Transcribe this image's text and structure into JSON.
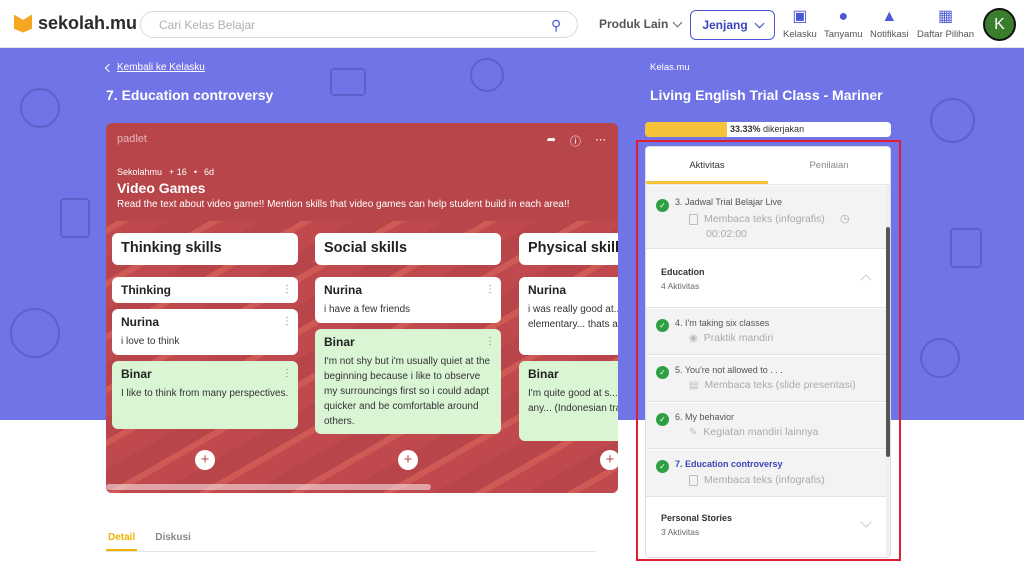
{
  "header": {
    "brand": "sekolah.mu",
    "search_placeholder": "Cari Kelas Belajar",
    "produk_label": "Produk Lain",
    "jenjang_label": "Jenjang",
    "nav": [
      {
        "label": "Kelasku",
        "icon": "book-icon"
      },
      {
        "label": "Tanyamu",
        "icon": "chat-icon"
      },
      {
        "label": "Notifikasi",
        "icon": "bell-icon"
      },
      {
        "label": "Daftar Pilihan",
        "icon": "bag-icon"
      }
    ],
    "avatar_initial": "K"
  },
  "content": {
    "back_label": "Kembali ke Kelasku",
    "title": "7. Education controversy",
    "detail_tabs": [
      "Detail",
      "Diskusi"
    ]
  },
  "padlet": {
    "brand": "padlet",
    "meta_author": "Sekolahmu",
    "meta_count": "+ 16",
    "meta_age": "6d",
    "heading": "Video Games",
    "description": "Read the text about video game!! Mention skills that video games can help student build in each area!!",
    "columns": [
      {
        "title": "Thinking skills",
        "cards": [
          {
            "author": "Thinking",
            "text": "",
            "green": false
          },
          {
            "author": "Nurina",
            "text": "i love to think",
            "green": false
          },
          {
            "author": "Binar",
            "text": "I like to think from many perspectives.",
            "green": true
          }
        ]
      },
      {
        "title": "Social skills",
        "cards": [
          {
            "author": "Nurina",
            "text": "i have a few friends",
            "green": false
          },
          {
            "author": "Binar",
            "text": "I'm not shy but i'm usually quiet at the beginning because i like to observe my surrouncings first so i could adapt quicker and be comfortable around others.",
            "green": true
          }
        ]
      },
      {
        "title": "Physical skills",
        "cards": [
          {
            "author": "Nurina",
            "text": "i was really good at... was in elementary... thats a good memo...",
            "green": false
          },
          {
            "author": "Binar",
            "text": "I'm quite good at s... mostly dancing any... (Indonesian traditi...",
            "green": true
          }
        ]
      }
    ]
  },
  "course": {
    "label": "Kelas.mu",
    "title": "Living English Trial Class - Mariner",
    "progress_percent": 33.33,
    "progress_value": "33.33%",
    "progress_suffix": "dikerjakan",
    "tabs": [
      "Aktivitas",
      "Penilaian"
    ],
    "items": [
      {
        "kind": "activity",
        "name": "3.  Jadwal Trial Belajar Live",
        "type": "Membaca teks (infografis)",
        "time": "00:02:00",
        "done": true
      },
      {
        "kind": "section",
        "title": "Education",
        "count": "4 Aktivitas"
      },
      {
        "kind": "activity",
        "name": "4.  I'm taking six classes",
        "type": "Praktik mandiri",
        "done": true
      },
      {
        "kind": "activity",
        "name": "5.  You're not allowed to . . .",
        "type": "Membaca teks (slide presentasi)",
        "done": true
      },
      {
        "kind": "activity",
        "name": "6.  My behavior",
        "type": "Kegiatan mandiri lainnya",
        "done": true
      },
      {
        "kind": "activity",
        "name": "7.  Education controversy",
        "type": "Membaca teks (infografis)",
        "done": true,
        "active": true
      },
      {
        "kind": "section",
        "title": "Personal Stories",
        "count": "3 Aktivitas"
      }
    ]
  },
  "colors": {
    "banner": "#7174e6",
    "accent": "#4b58d6",
    "highlight_frame": "#e02030",
    "progress": "#f6c23a",
    "done": "#2ea043"
  }
}
